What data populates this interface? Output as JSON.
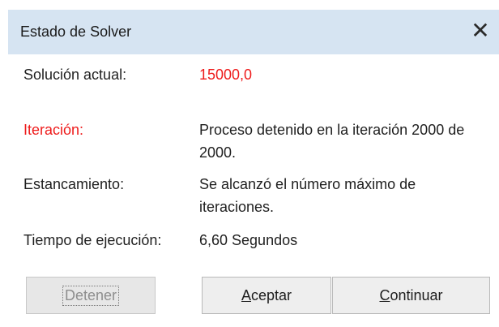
{
  "window": {
    "title": "Estado de Solver",
    "close_icon": "close-icon"
  },
  "status": {
    "current_solution_label": "Solución actual:",
    "current_solution_value": "15000,0",
    "iteration_label": "Iteración:",
    "iteration_value": "Proceso detenido en la iteración 2000 de 2000.",
    "stagnation_label": "Estancamiento:",
    "stagnation_value": "Se alcanzó el número máximo de iteraciones.",
    "runtime_label": "Tiempo de ejecución:",
    "runtime_value": "6,60 Segundos"
  },
  "buttons": {
    "stop": "Detener",
    "accept_mnemonic": "A",
    "accept_rest": "ceptar",
    "continue_mnemonic": "C",
    "continue_rest": "ontinuar"
  },
  "colors": {
    "highlight": "#ee1b1b",
    "titlebar": "#d6e4f2"
  }
}
